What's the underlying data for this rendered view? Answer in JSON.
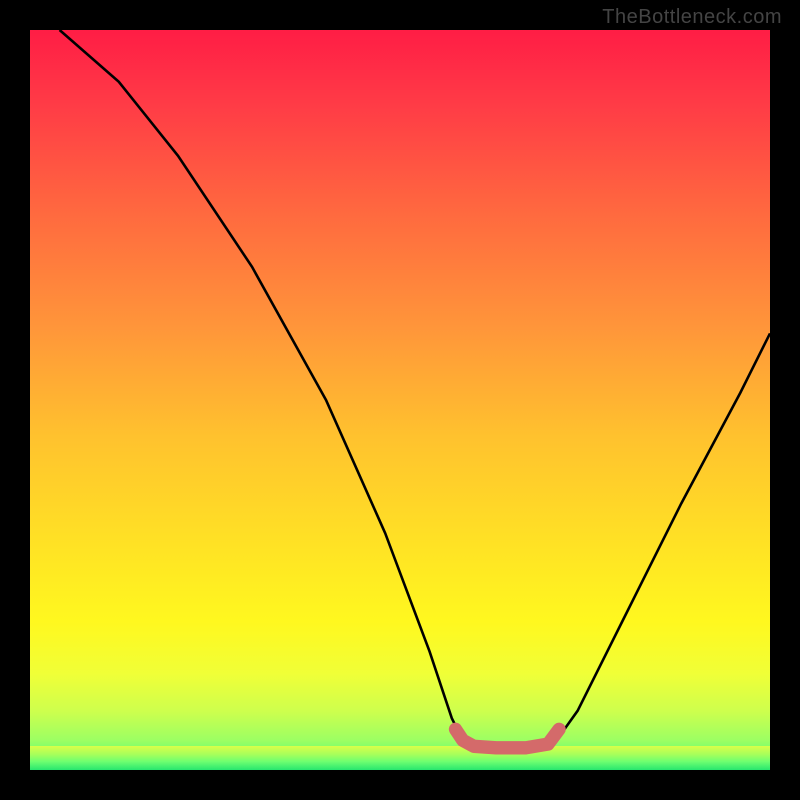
{
  "watermark_text": "TheBottleneck.com",
  "chart_data": {
    "type": "area",
    "title": "",
    "xlabel": "",
    "ylabel": "",
    "xlim": [
      0,
      100
    ],
    "ylim": [
      0,
      100
    ],
    "grid": false,
    "legend": false,
    "background_gradient": {
      "top": "#ff1d45",
      "upper_mid": "#ff953a",
      "mid": "#ffe324",
      "lower_mid": "#ceff4d",
      "bottom": "#16e86f"
    },
    "series": [
      {
        "name": "bottleneck-curve",
        "color": "#000000",
        "stroke_width": 2,
        "points": [
          {
            "x": 4,
            "y": 100
          },
          {
            "x": 12,
            "y": 93
          },
          {
            "x": 20,
            "y": 83
          },
          {
            "x": 30,
            "y": 68
          },
          {
            "x": 40,
            "y": 50
          },
          {
            "x": 48,
            "y": 32
          },
          {
            "x": 54,
            "y": 16
          },
          {
            "x": 57,
            "y": 7
          },
          {
            "x": 58.5,
            "y": 4
          },
          {
            "x": 60,
            "y": 3.2
          },
          {
            "x": 63,
            "y": 3
          },
          {
            "x": 67,
            "y": 3
          },
          {
            "x": 70,
            "y": 3.5
          },
          {
            "x": 71.5,
            "y": 4.5
          },
          {
            "x": 74,
            "y": 8
          },
          {
            "x": 80,
            "y": 20
          },
          {
            "x": 88,
            "y": 36
          },
          {
            "x": 96,
            "y": 51
          },
          {
            "x": 100,
            "y": 59
          }
        ]
      },
      {
        "name": "optimal-zone-marker",
        "color": "#d46a6a",
        "stroke_width": 12,
        "linecap": "round",
        "points": [
          {
            "x": 57.5,
            "y": 5.5
          },
          {
            "x": 58.5,
            "y": 4
          },
          {
            "x": 60,
            "y": 3.2
          },
          {
            "x": 63,
            "y": 3
          },
          {
            "x": 67,
            "y": 3
          },
          {
            "x": 70,
            "y": 3.5
          },
          {
            "x": 71.5,
            "y": 5.5
          }
        ]
      }
    ]
  }
}
